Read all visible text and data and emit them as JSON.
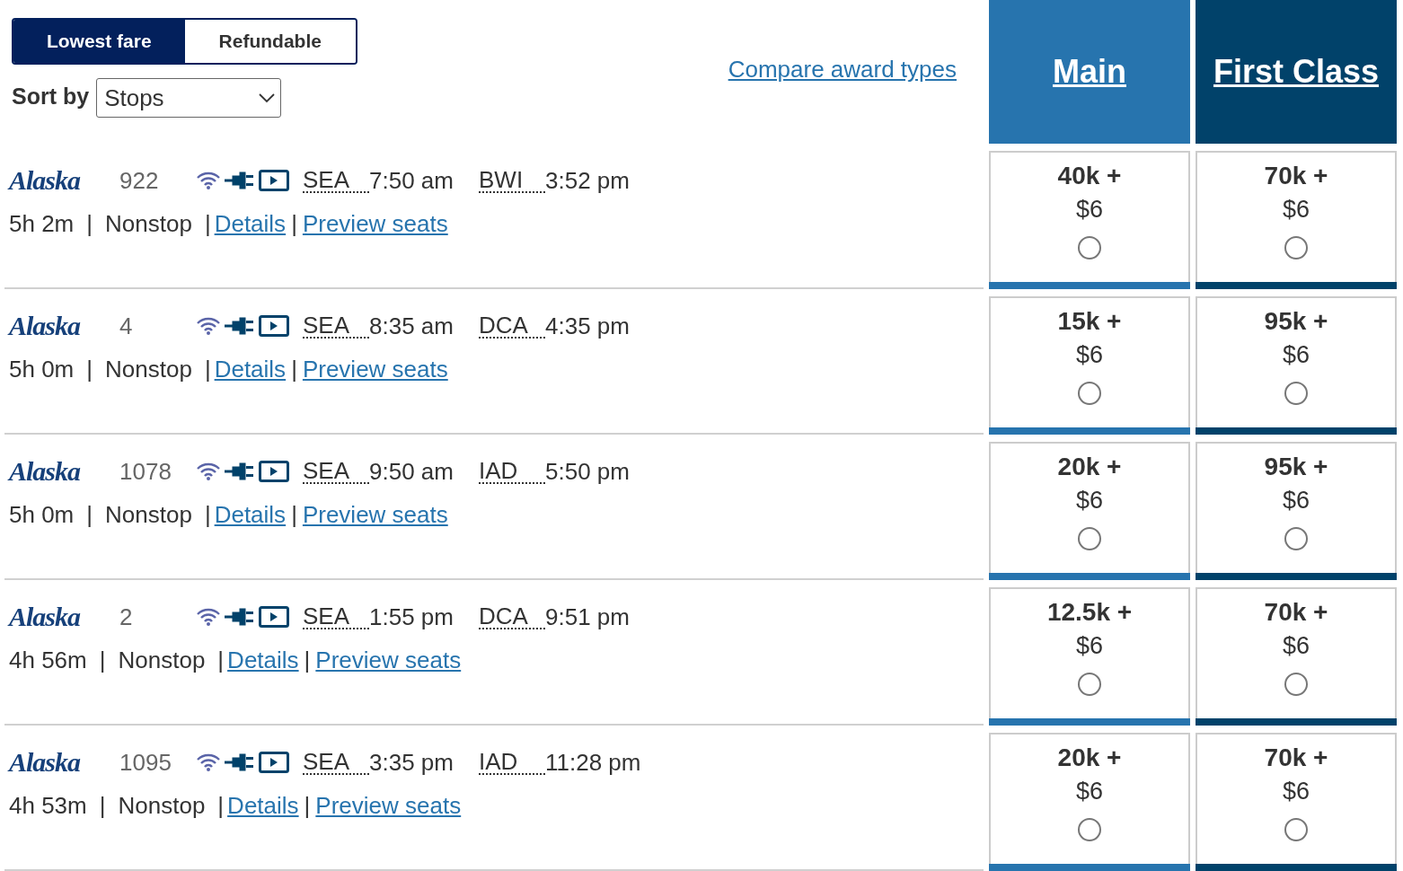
{
  "fare_toggle": [
    {
      "label": "Lowest fare",
      "selected": true
    },
    {
      "label": "Refundable",
      "selected": false
    }
  ],
  "sort": {
    "label": "Sort by",
    "value": "Stops"
  },
  "compare_link": "Compare award types",
  "cabins": [
    {
      "label": "Main",
      "color": "#2774ae"
    },
    {
      "label": "First Class",
      "color": "#01426a"
    }
  ],
  "separator": "|",
  "flights": [
    {
      "airline": "Alaska",
      "number": "922",
      "origin": "SEA",
      "departs": "7:50 am",
      "destination": "BWI",
      "arrives": "3:52 pm",
      "duration": "5h 2m",
      "stops": "Nonstop",
      "details": "Details",
      "seats": "Preview seats",
      "fares": [
        {
          "points": "40k +",
          "price": "$6",
          "selected": false
        },
        {
          "points": "70k +",
          "price": "$6",
          "selected": false
        }
      ]
    },
    {
      "airline": "Alaska",
      "number": "4",
      "origin": "SEA",
      "departs": "8:35 am",
      "destination": "DCA",
      "arrives": "4:35 pm",
      "duration": "5h 0m",
      "stops": "Nonstop",
      "details": "Details",
      "seats": "Preview seats",
      "fares": [
        {
          "points": "15k +",
          "price": "$6",
          "selected": false
        },
        {
          "points": "95k +",
          "price": "$6",
          "selected": false
        }
      ]
    },
    {
      "airline": "Alaska",
      "number": "1078",
      "origin": "SEA",
      "departs": "9:50 am",
      "destination": "IAD",
      "arrives": "5:50 pm",
      "duration": "5h 0m",
      "stops": "Nonstop",
      "details": "Details",
      "seats": "Preview seats",
      "fares": [
        {
          "points": "20k +",
          "price": "$6",
          "selected": false
        },
        {
          "points": "95k +",
          "price": "$6",
          "selected": false
        }
      ]
    },
    {
      "airline": "Alaska",
      "number": "2",
      "origin": "SEA",
      "departs": "1:55 pm",
      "destination": "DCA",
      "arrives": "9:51 pm",
      "duration": "4h 56m",
      "stops": "Nonstop",
      "details": "Details",
      "seats": "Preview seats",
      "fares": [
        {
          "points": "12.5k +",
          "price": "$6",
          "selected": false
        },
        {
          "points": "70k +",
          "price": "$6",
          "selected": false
        }
      ]
    },
    {
      "airline": "Alaska",
      "number": "1095",
      "origin": "SEA",
      "departs": "3:35 pm",
      "destination": "IAD",
      "arrives": "11:28 pm",
      "duration": "4h 53m",
      "stops": "Nonstop",
      "details": "Details",
      "seats": "Preview seats",
      "fares": [
        {
          "points": "20k +",
          "price": "$6",
          "selected": false
        },
        {
          "points": "70k +",
          "price": "$6",
          "selected": false
        }
      ]
    }
  ]
}
